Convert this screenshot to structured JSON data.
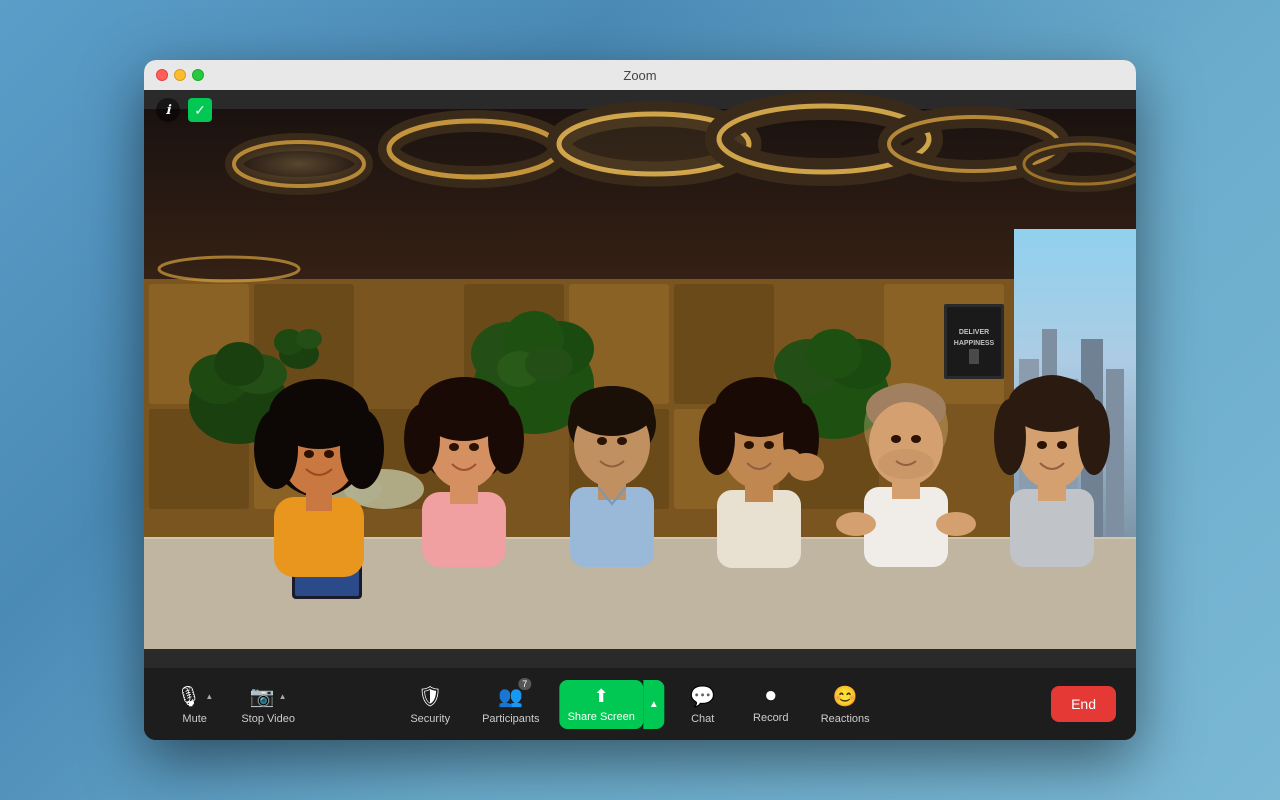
{
  "window": {
    "title": "Zoom",
    "trafficLights": {
      "close": "close",
      "minimize": "minimize",
      "maximize": "maximize"
    }
  },
  "infoBar": {
    "infoIcon": "ℹ",
    "securityIcon": "✓"
  },
  "toolbar": {
    "mute": {
      "label": "Mute",
      "icon": "🎙",
      "hasChevron": true
    },
    "stopVideo": {
      "label": "Stop Video",
      "icon": "📷",
      "hasChevron": true
    },
    "security": {
      "label": "Security",
      "icon": "🛡"
    },
    "participants": {
      "label": "Participants",
      "icon": "👥",
      "count": "7"
    },
    "shareScreen": {
      "label": "Share Screen",
      "icon": "⬆",
      "active": true
    },
    "chat": {
      "label": "Chat",
      "icon": "💬"
    },
    "record": {
      "label": "Record",
      "icon": "⏺"
    },
    "reactions": {
      "label": "Reactions",
      "icon": "😊"
    },
    "end": {
      "label": "End"
    }
  }
}
